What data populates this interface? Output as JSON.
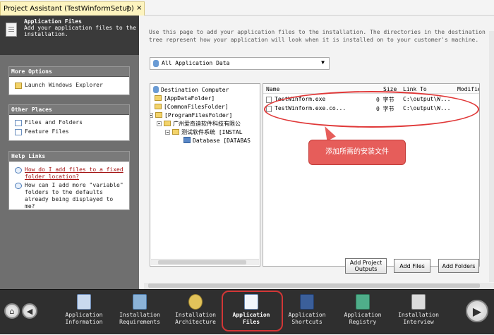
{
  "titlebar": {
    "tab_title": "Project Assistant (TestWinformSetup)",
    "pin_glyph": "‡",
    "close_glyph": "×"
  },
  "banner": {
    "title": "Application Files",
    "subtitle": "Add your application files to the installation."
  },
  "more_options": {
    "header": "More Options",
    "items": [
      {
        "label": "Launch Windows Explorer",
        "icon": "folder-icon"
      }
    ]
  },
  "other_places": {
    "header": "Other Places",
    "items": [
      {
        "label": "Files and Folders",
        "icon": "page-icon"
      },
      {
        "label": "Feature Files",
        "icon": "page-icon"
      }
    ]
  },
  "help_links": {
    "header": "Help Links",
    "items": [
      {
        "label": "How do I add files to a fixed folder location?",
        "icon": "help-icon",
        "is_link": true
      },
      {
        "label": "How can I add more \"variable\" folders to the defaults already being displayed to me?",
        "icon": "help-icon",
        "is_link": false
      }
    ]
  },
  "main": {
    "intro": "Use this page to add your application files to the installation. The directories in the destination tree represent how your application will look when it is installed on to your customer's machine.",
    "data_select": {
      "value": "All Application Data",
      "arrow": "▼"
    }
  },
  "tree": {
    "root": "Destination Computer",
    "nodes": [
      {
        "label": "[AppDataFolder]"
      },
      {
        "label": "[CommonFilesFolder]"
      },
      {
        "label": "[ProgramFilesFolder]"
      },
      {
        "label": "广州爱奇迪软件科技有限公"
      },
      {
        "label": "测试软件系统 [INSTAL"
      },
      {
        "label": "Database [DATABAS"
      }
    ]
  },
  "filelist": {
    "columns": [
      "Name",
      "Size",
      "Link To",
      "Modifie"
    ],
    "rows": [
      {
        "name": "TestWinform.exe",
        "size": "0 字节",
        "link": "C:\\output\\W..."
      },
      {
        "name": "TestWinform.exe.co...",
        "size": "0 字节",
        "link": "C:\\output\\W..."
      }
    ]
  },
  "callout": {
    "text": "添加所需的安装文件"
  },
  "buttons": {
    "add_project_outputs": "Add Project Outputs",
    "add_files": "Add Files",
    "add_folders": "Add Folders"
  },
  "navbar": {
    "home_glyph": "⌂",
    "back_glyph": "◀",
    "forward_glyph": "▶",
    "steps": [
      {
        "label": "Application Information",
        "icon": "info-icon",
        "active": false
      },
      {
        "label": "Installation Requirements",
        "icon": "requirements-icon",
        "active": false
      },
      {
        "label": "Installation Architecture",
        "icon": "architecture-icon",
        "active": false
      },
      {
        "label": "Application Files",
        "icon": "files-icon",
        "active": true
      },
      {
        "label": "Application Shortcuts",
        "icon": "shortcuts-icon",
        "active": false
      },
      {
        "label": "Application Registry",
        "icon": "registry-icon",
        "active": false
      },
      {
        "label": "Installation Interview",
        "icon": "interview-icon",
        "active": false
      }
    ]
  }
}
